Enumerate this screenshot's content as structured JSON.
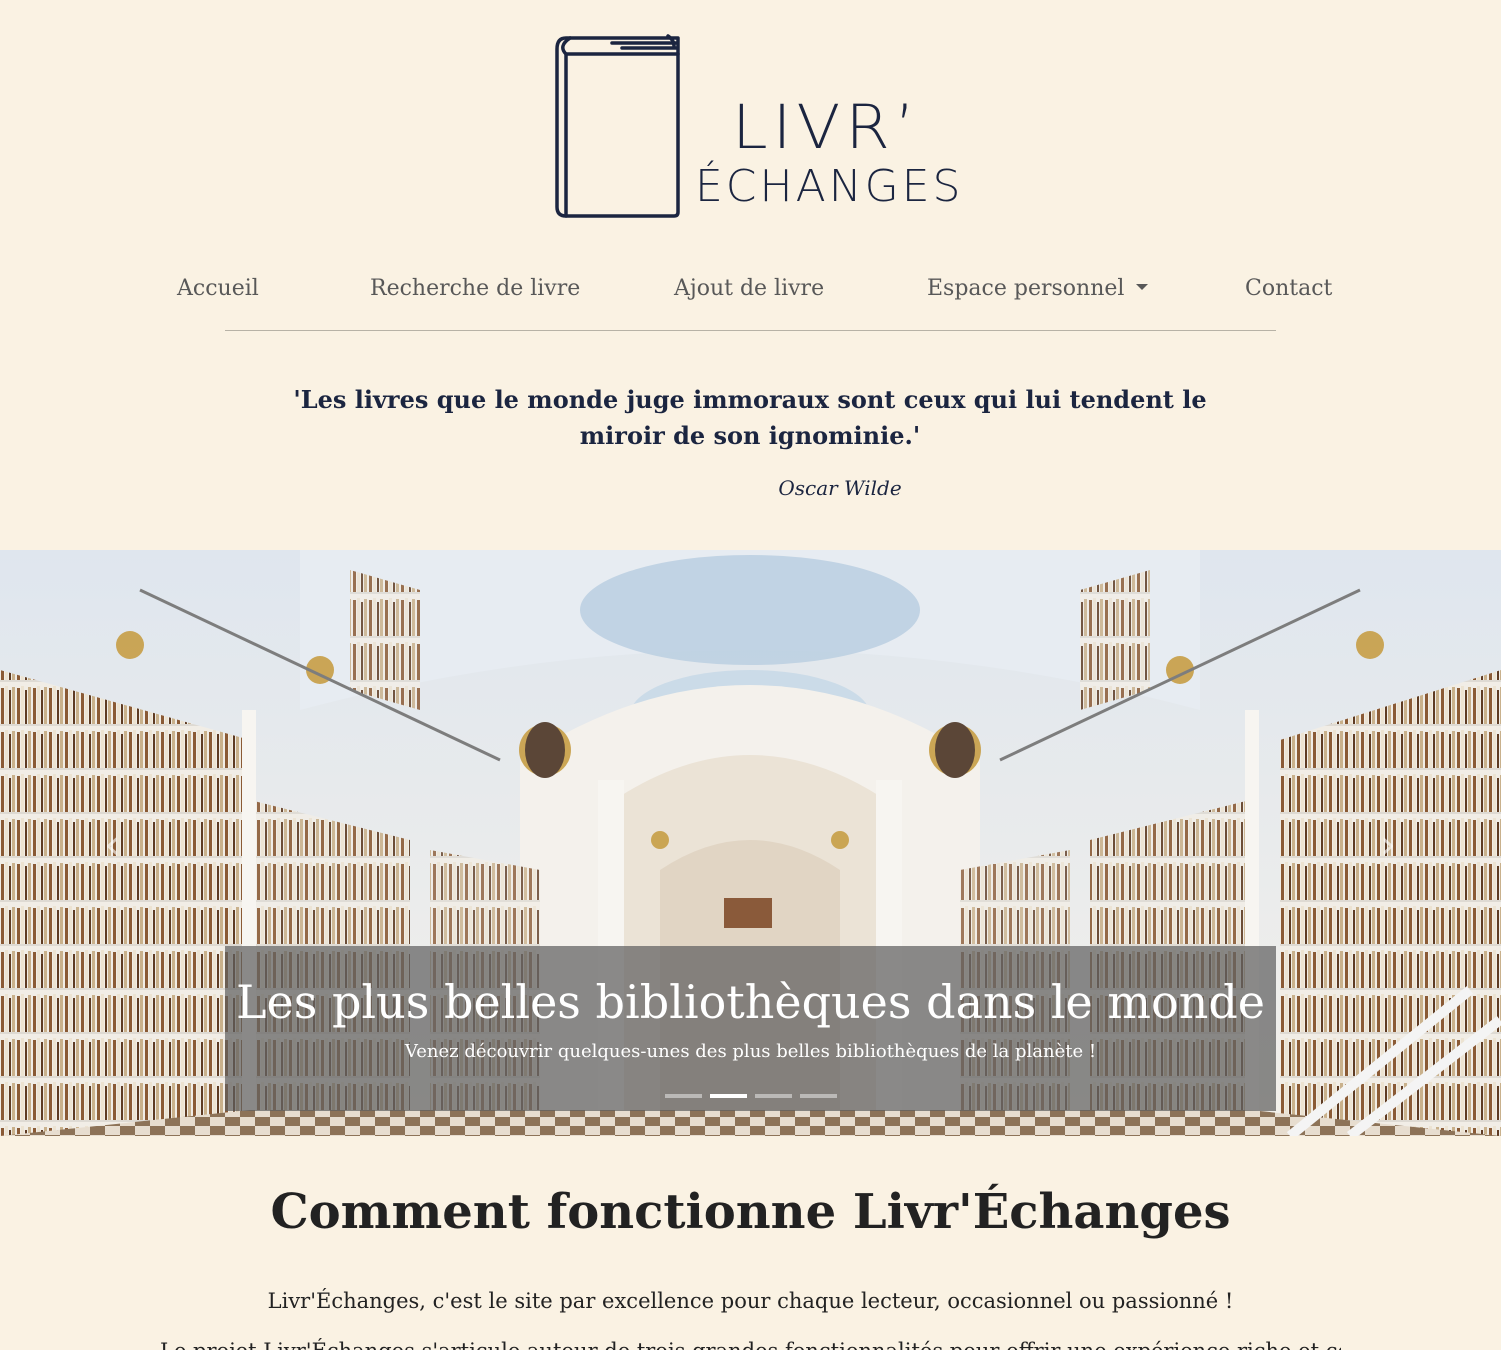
{
  "logo": {
    "line1": "LIVR’",
    "line2": "ÉCHANGES"
  },
  "nav": {
    "items": [
      {
        "label": "Accueil"
      },
      {
        "label": "Recherche de livre"
      },
      {
        "label": "Ajout de livre"
      },
      {
        "label": "Espace personnel"
      },
      {
        "label": "Contact"
      }
    ]
  },
  "quote": {
    "text": "'Les livres que le monde juge immoraux sont ceux qui lui tendent le miroir de son ignominie.'",
    "author": "Oscar Wilde"
  },
  "carousel": {
    "caption_title": "Les plus belles bibliothèques dans le monde",
    "caption_text": "Venez découvrir quelques-unes des plus belles bibliothèques de la planète !",
    "prev_glyph": "‹",
    "next_glyph": "›",
    "slide_count": 4,
    "active_index": 1
  },
  "section": {
    "title": "Comment fonctionne Livr'Échanges",
    "intro": "Livr'Échanges, c'est le site par excellence pour chaque lecteur, occasionnel ou passionné !",
    "body": "Le projet Livr'Échanges s'articule autour de trois grandes fonctionnalités pour offrir une expérience riche et complète"
  },
  "colors": {
    "background": "#faf2e3",
    "brand_navy": "#1b2540",
    "nav_text": "#585858"
  }
}
